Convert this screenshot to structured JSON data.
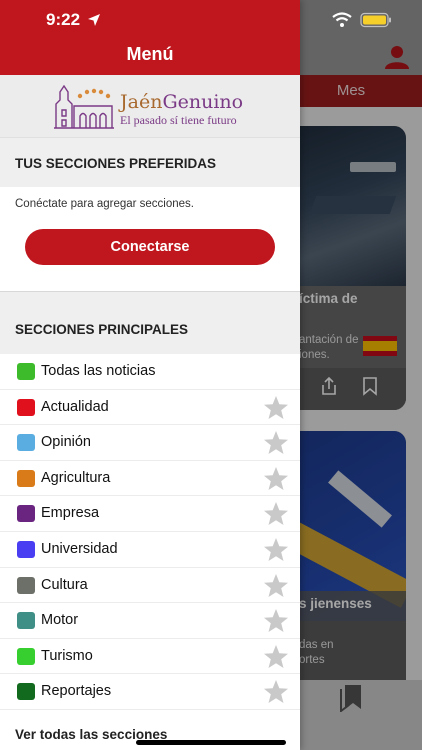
{
  "status_bar": {
    "time": "9:22"
  },
  "drawer": {
    "title": "Menú",
    "logo": {
      "name_part1": "Jaén",
      "name_part2": "Genuino",
      "tagline": "El pasado sí tiene futuro"
    },
    "preferred": {
      "heading": "TUS SECCIONES PREFERIDAS",
      "hint": "Conéctate para agregar secciones.",
      "connect_label": "Conectarse"
    },
    "main": {
      "heading": "SECCIONES PRINCIPALES",
      "items": [
        {
          "label": "Todas las noticias",
          "color": "#3dbb2b",
          "starrable": false
        },
        {
          "label": "Actualidad",
          "color": "#e0111d",
          "starrable": true
        },
        {
          "label": "Opinión",
          "color": "#5aade0",
          "starrable": true
        },
        {
          "label": "Agricultura",
          "color": "#d97b18",
          "starrable": true
        },
        {
          "label": "Empresa",
          "color": "#6a2581",
          "starrable": true
        },
        {
          "label": "Universidad",
          "color": "#4a3ef2",
          "starrable": true
        },
        {
          "label": "Cultura",
          "color": "#6d7068",
          "starrable": true
        },
        {
          "label": "Motor",
          "color": "#3f8f86",
          "starrable": true
        },
        {
          "label": "Turismo",
          "color": "#36cf2f",
          "starrable": true
        },
        {
          "label": "Reportajes",
          "color": "#126a1e",
          "starrable": true
        }
      ],
      "see_all": "Ver todas las secciones"
    }
  },
  "background": {
    "tab_label": "Mes",
    "card1": {
      "title": "íctima de",
      "body_line1": "antación de",
      "body_line2": "iones."
    },
    "card2": {
      "title": "s jienenses",
      "body_line1": "das en",
      "body_line2": "ortes"
    }
  },
  "colors": {
    "brand_red": "#c0161e"
  }
}
